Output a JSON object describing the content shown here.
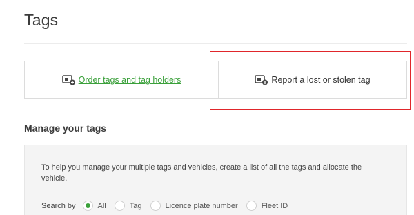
{
  "page": {
    "title": "Tags"
  },
  "actions": {
    "order_label": "Order tags and tag holders",
    "report_label": "Report a lost or stolen tag"
  },
  "manage": {
    "title": "Manage your tags",
    "info": "To help you manage your multiple tags and vehicles, create a list of all the tags and allocate the vehicle.",
    "search_by_label": "Search by",
    "options": [
      {
        "label": "All",
        "selected": true
      },
      {
        "label": "Tag",
        "selected": false
      },
      {
        "label": "Licence plate number",
        "selected": false
      },
      {
        "label": "Fleet ID",
        "selected": false
      }
    ]
  },
  "colors": {
    "accent": "#3aa03a",
    "highlight": "#e0262b"
  }
}
